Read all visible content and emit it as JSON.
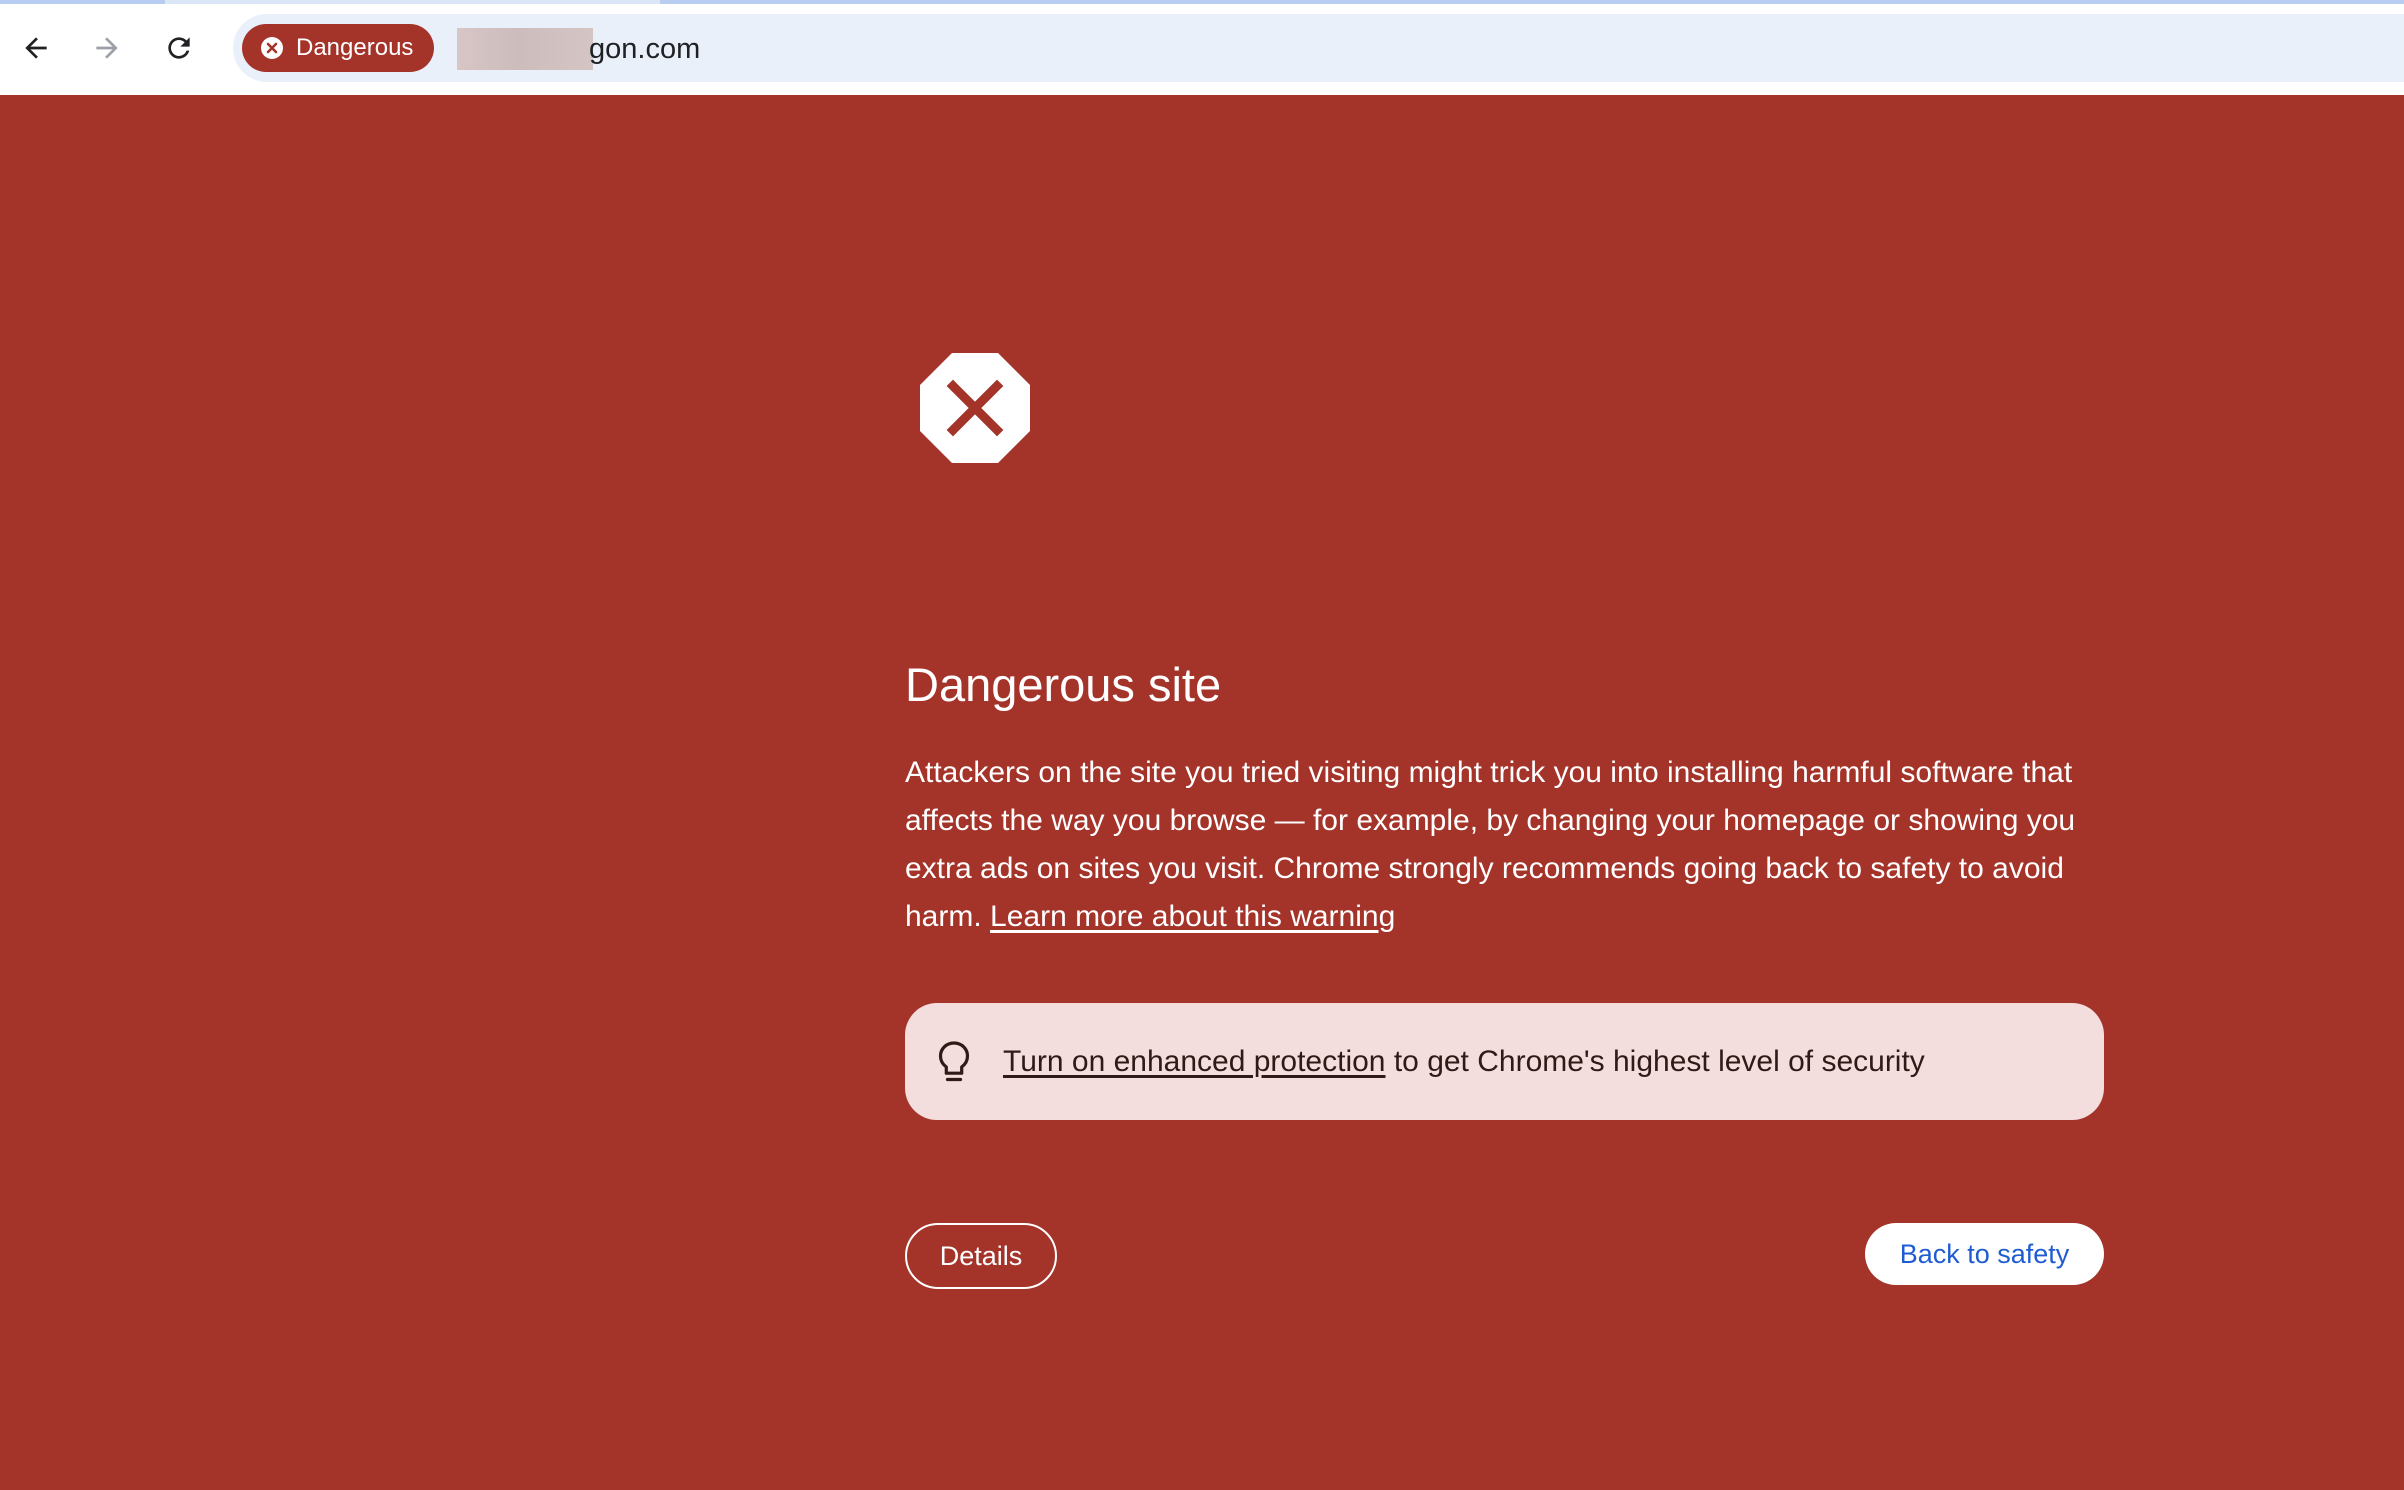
{
  "browser": {
    "nav": {
      "back_icon": "arrow-left-icon",
      "forward_icon": "arrow-right-icon",
      "reload_icon": "reload-icon"
    },
    "security_chip": {
      "label": "Dangerous",
      "icon": "error-circle-icon"
    },
    "url": {
      "visible_suffix": "gon.com",
      "blurred_prefix": true
    }
  },
  "interstitial": {
    "icon": "stop-sign-x-icon",
    "title": "Dangerous site",
    "body": "Attackers on the site you tried visiting might trick you into installing harmful software that affects the way you browse — for example, by changing your homepage or showing you extra ads on sites you visit. Chrome strongly recommends going back to safety to avoid harm.",
    "learn_more_link": "Learn more about this warning",
    "enhanced_protection": {
      "icon": "lightbulb-icon",
      "link_text": "Turn on enhanced protection",
      "rest_text": " to get Chrome's highest level of security"
    },
    "details_button": "Details",
    "back_button": "Back to safety"
  },
  "colors": {
    "danger_red": "#a43329",
    "omnibox_bg": "#eaf0fa",
    "protect_box_bg": "#f3dedd",
    "link_blue": "#1f5bd1"
  }
}
